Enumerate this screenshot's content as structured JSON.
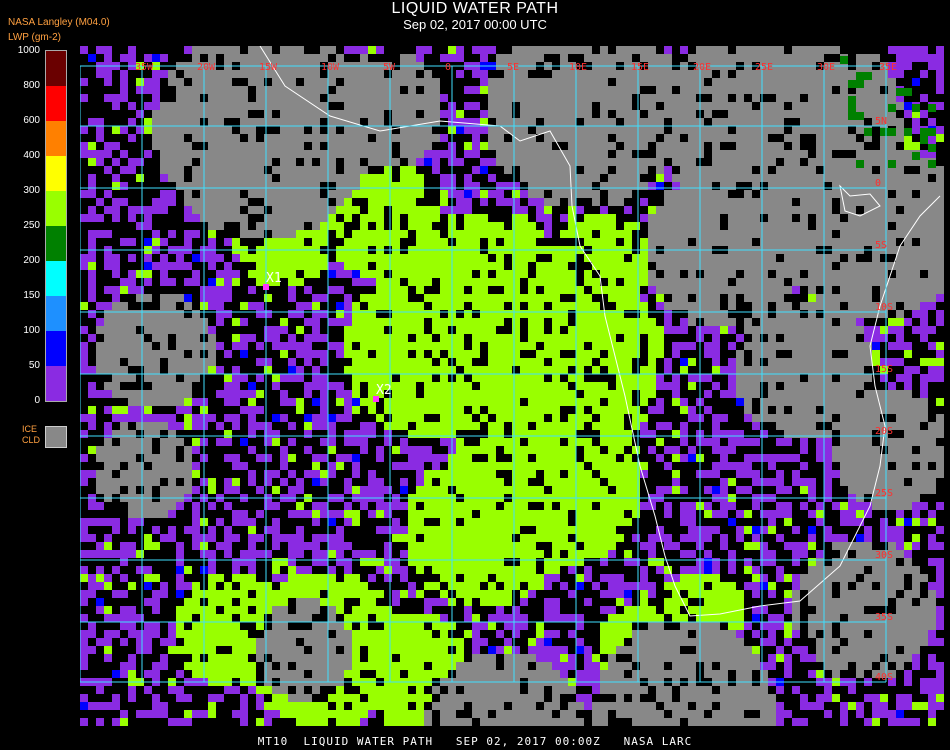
{
  "header": {
    "title": "LIQUID WATER PATH",
    "subtitle": "Sep 02, 2017 00:00 UTC",
    "source": "NASA Langley (M04.0)",
    "units": "LWP (gm-2)"
  },
  "legend": {
    "ticks": [
      "1000",
      "800",
      "600",
      "400",
      "300",
      "250",
      "200",
      "150",
      "100",
      "50",
      "0"
    ],
    "colors": [
      "#6a0000",
      "#ff0000",
      "#ff8000",
      "#ffff00",
      "#99ff00",
      "#008000",
      "#00ffff",
      "#1e90ff",
      "#0000ff",
      "#8a2be2"
    ],
    "ice_label_1": "ICE",
    "ice_label_2": "CLD",
    "ice_color": "#888888"
  },
  "map": {
    "lon_labels": [
      "35W",
      "20W",
      "15W",
      "10W",
      "5W",
      "0",
      "5E",
      "10E",
      "15E",
      "20E",
      "25E",
      "30E",
      "35E"
    ],
    "lat_labels": [
      "5N",
      "0",
      "5S",
      "10S",
      "15S",
      "20S",
      "25S",
      "30S",
      "35S",
      "40S"
    ],
    "markers": [
      "X1",
      "X2"
    ],
    "colors": {
      "ice": "#888888",
      "lwp_250_300": "#99ff00",
      "lwp_0_50": "#8a2be2",
      "grid": "#3fe0ff",
      "coast": "#ffffff",
      "labels": "#ff3030"
    }
  },
  "footer": "MT10  LIQUID WATER PATH   SEP 02, 2017 00:00Z   NASA LARC"
}
